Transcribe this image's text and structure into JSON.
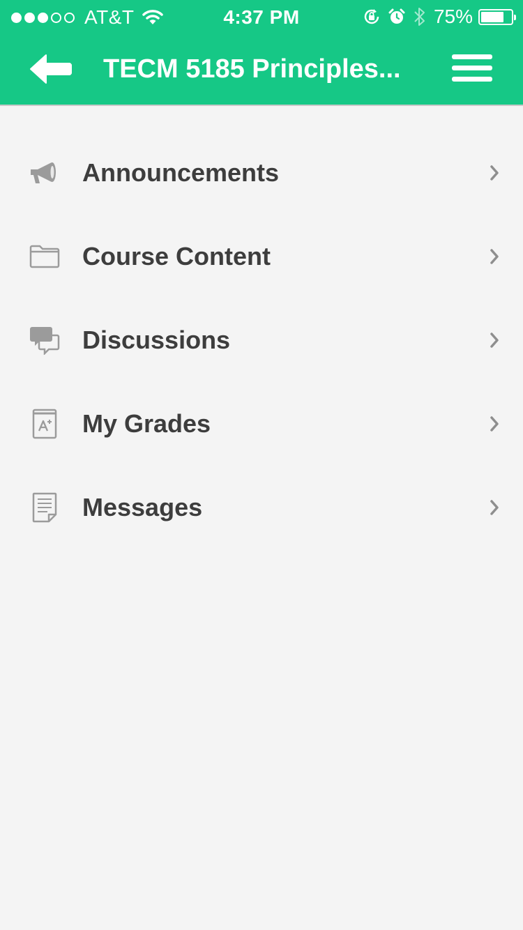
{
  "status_bar": {
    "carrier": "AT&T",
    "time": "4:37 PM",
    "battery": "75%",
    "battery_level": 0.75
  },
  "header": {
    "title": "TECM 5185 Principles..."
  },
  "menu": {
    "items": [
      {
        "label": "Announcements",
        "icon": "megaphone-icon"
      },
      {
        "label": "Course Content",
        "icon": "folder-icon"
      },
      {
        "label": "Discussions",
        "icon": "chat-bubbles-icon"
      },
      {
        "label": "My Grades",
        "icon": "grade-icon"
      },
      {
        "label": "Messages",
        "icon": "document-icon"
      }
    ]
  },
  "colors": {
    "header_bg": "#16c886",
    "background": "#f4f4f4",
    "text": "#3d3d3d",
    "icon": "#9b9b9b"
  }
}
